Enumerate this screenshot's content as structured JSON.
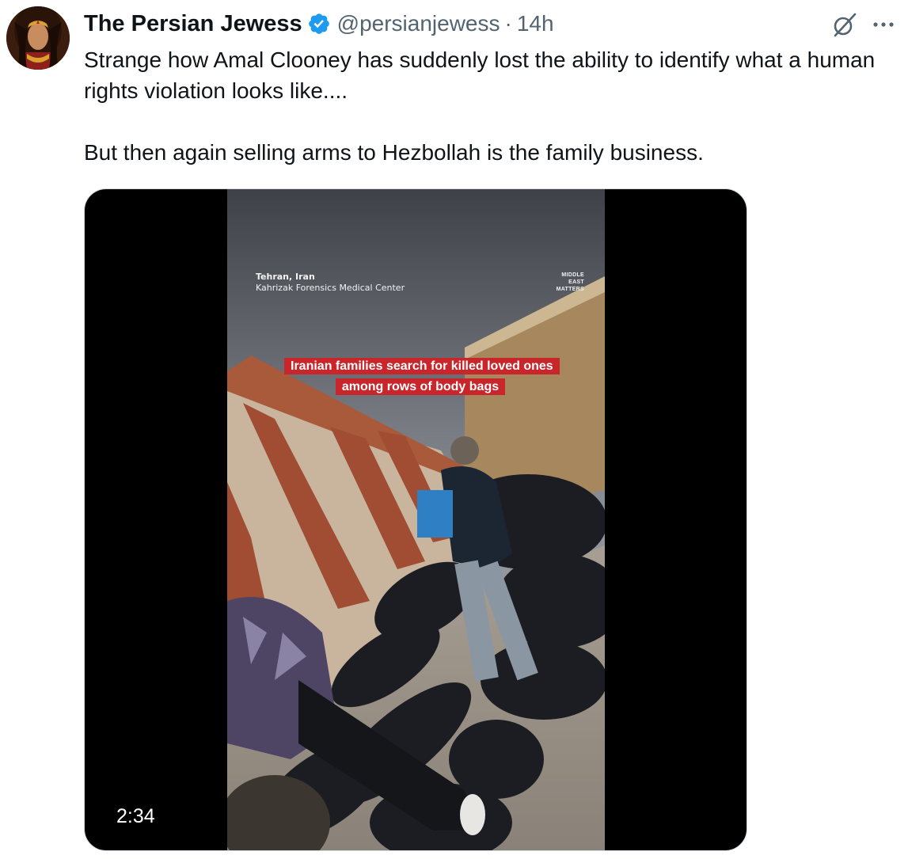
{
  "author": {
    "display_name": "The Persian Jewess",
    "handle": "@persianjewess",
    "separator": "·",
    "timestamp": "14h",
    "verified": true
  },
  "tweet": {
    "line1": "Strange how Amal Clooney has suddenly lost the ability to identify what a human rights violation looks like....",
    "line2": "But then again selling arms to Hezbollah is the family business."
  },
  "media": {
    "duration": "2:34",
    "location_city": "Tehran, Iran",
    "location_place": "Kahrizak Forensics Medical Center",
    "brand_line1": "MIDDLE",
    "brand_line2": "EAST",
    "brand_line3": "MATTERS",
    "caption": "Iranian families search for killed loved ones among rows of body bags"
  },
  "colors": {
    "verified_blue": "#1d9bf0",
    "secondary_text": "#536471",
    "caption_red": "#c8262b"
  },
  "icons": {
    "grok": "grok-icon",
    "more": "more-icon",
    "verified": "verified-badge-icon"
  }
}
